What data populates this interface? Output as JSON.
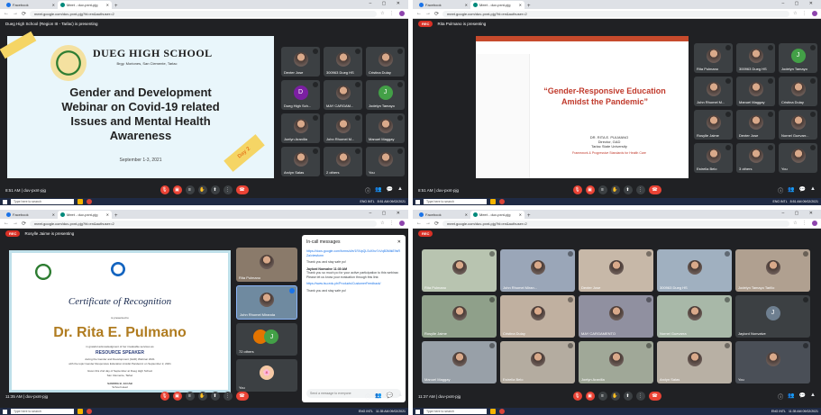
{
  "q1": {
    "tabs": [
      "Facebook",
      "Meet - duv-pxnt-pjg"
    ],
    "url": "meet.google.com/duv-pxnt-pjg?hl=en&authuser=2",
    "presenting": "Dueg High School (Region III - Tarlac) is presenting",
    "slide": {
      "school": "DUEG HIGH SCHOOL",
      "address": "Brgy. Moriones, San Clemente, Tarlac",
      "title_lines": [
        "Gender and Development",
        "Webinar on Covid-19 related",
        "Issues and Mental Health",
        "Awareness"
      ],
      "date": "September 1-3, 2021",
      "badge": "Day 2"
    },
    "participants": [
      {
        "name": "Dexter Jose",
        "letter": "",
        "color": ""
      },
      {
        "name": "300963 Dueg HS",
        "letter": "",
        "color": ""
      },
      {
        "name": "Cristina Dulay",
        "letter": "",
        "color": ""
      },
      {
        "name": "Dueg High Sch...",
        "letter": "D",
        "color": "#7b1fa2"
      },
      {
        "name": "MAY CARGAM...",
        "letter": "",
        "color": ""
      },
      {
        "name": "Jodelyn Tamayo",
        "letter": "J",
        "color": "#43a047"
      },
      {
        "name": "Joelyn Aranilla",
        "letter": "",
        "color": ""
      },
      {
        "name": "John Rhomel M...",
        "letter": "",
        "color": ""
      },
      {
        "name": "Manuel Maggay",
        "letter": "",
        "color": ""
      },
      {
        "name": "Arclyn Salas",
        "letter": "",
        "color": ""
      },
      {
        "name": "2 others",
        "letter": "",
        "color": ""
      },
      {
        "name": "You",
        "letter": "",
        "color": ""
      }
    ],
    "time": "8:51 AM",
    "meeting_code": "duv-pxnt-pjg"
  },
  "q2": {
    "tabs": [
      "Facebook",
      "Meet - duv-pxnt-pjg"
    ],
    "url": "meet.google.com/duv-pxnt-pjg?hl=en&authuser=2",
    "rec": "REC",
    "presenting": "Rita Pulmano is presenting",
    "slide": {
      "title": "“Gender-Responsive Education Amidst the Pandemic”",
      "presenter": "DR. RITA E. PULMANO",
      "role": "Director, GAD",
      "org": "Tarlac State University",
      "foot": "Framework & Progressive Standards for Health Care"
    },
    "participants": [
      {
        "name": "Rita Pulmano",
        "letter": "",
        "color": ""
      },
      {
        "name": "300963 Dueg HS",
        "letter": "",
        "color": ""
      },
      {
        "name": "Jodelyn Tamayo",
        "letter": "J",
        "color": "#43a047"
      },
      {
        "name": "John Rhomel M...",
        "letter": "",
        "color": ""
      },
      {
        "name": "Manuel Maggay",
        "letter": "",
        "color": ""
      },
      {
        "name": "Cristina Dulay",
        "letter": "",
        "color": ""
      },
      {
        "name": "Rosylle Jaime",
        "letter": "",
        "color": ""
      },
      {
        "name": "Dexter Jose",
        "letter": "",
        "color": ""
      },
      {
        "name": "Nornel Guevarr...",
        "letter": "",
        "color": ""
      },
      {
        "name": "Estrella Belo",
        "letter": "",
        "color": ""
      },
      {
        "name": "3 others",
        "letter": "",
        "color": ""
      },
      {
        "name": "You",
        "letter": "",
        "color": ""
      }
    ],
    "time": "8:51 AM",
    "meeting_code": "duv-pxnt-pjg"
  },
  "q3": {
    "tabs": [
      "Facebook",
      "Meet - duv-pxnt-pjg"
    ],
    "url": "meet.google.com/duv-pxnt-pjg?hl=en&authuser=2",
    "rec": "REC",
    "presenting": "Rosylle Jaime is presenting",
    "cert": {
      "heading": "Certificate of Recognition",
      "presented_to": "is presented to",
      "name": "Dr. Rita E. Pulmano",
      "grateful": "in grateful acknowledgment of her invaluable services as",
      "role": "RESOURCE SPEAKER",
      "during": "during the Gender and Development (GAD) Webinar 2021",
      "topic": "with the topic Gender Responsive Education Amidst Pandemic on September 2, 2021",
      "given": "Given this 2nd day of September at Dueg High School",
      "place": "San Clemente, Tarlac",
      "signer": "SANDRA B. JACAB",
      "signer_role": "School Head"
    },
    "side": [
      {
        "name": "Rita Pulmano"
      },
      {
        "name": "John Rhomel Miranda"
      },
      {
        "name": "72 others"
      },
      {
        "name": "You"
      }
    ],
    "chat": {
      "title": "In-call messages",
      "link1": "https://docs.google.com/forms/d/e/1FAIpQLSdXhv7cVqB3MtkE9sRZa/viewform",
      "msg1": "Thank you and stay safe po!",
      "sender": "Jaylord Nonvalve 11:30 AM",
      "msg2": "Thank you so much po for your active participation to this webinar. Please let us know your evaluation through this link:",
      "link2": "https://www.tsu.edu.ph/Products/CustomerFeedback/",
      "msg3": "Thank you and stay safe po!",
      "input_placeholder": "Send a message to everyone"
    },
    "time": "11:35 AM",
    "meeting_code": "duv-pxnt-pjg"
  },
  "q4": {
    "tabs": [
      "Facebook",
      "Meet - duv-pxnt-pjg"
    ],
    "url": "meet.google.com/duv-pxnt-pjg?hl=en&authuser=2",
    "rec": "REC",
    "participants": [
      {
        "name": "Rita Pulmano",
        "letter": "",
        "color": ""
      },
      {
        "name": "John Rhomel Miran...",
        "letter": "",
        "color": ""
      },
      {
        "name": "Dexter Jose",
        "letter": "",
        "color": ""
      },
      {
        "name": "300963 Dueg HS",
        "letter": "",
        "color": ""
      },
      {
        "name": "Jodelyn Tamayo Tarillo",
        "letter": "",
        "color": ""
      },
      {
        "name": "Rosylle Jaime",
        "letter": "",
        "color": ""
      },
      {
        "name": "Cristina Dulay",
        "letter": "",
        "color": ""
      },
      {
        "name": "MAY CARGAMENTO",
        "letter": "",
        "color": ""
      },
      {
        "name": "Nornel Guevarra",
        "letter": "",
        "color": ""
      },
      {
        "name": "Jaylord Nonvalve",
        "letter": "J",
        "color": "#6e7f90"
      },
      {
        "name": "Manuel Maggay",
        "letter": "",
        "color": ""
      },
      {
        "name": "Estrella Belo",
        "letter": "",
        "color": ""
      },
      {
        "name": "Joelyn Aranilla",
        "letter": "",
        "color": ""
      },
      {
        "name": "Arclyn Salas",
        "letter": "",
        "color": ""
      },
      {
        "name": "You",
        "letter": "",
        "color": ""
      }
    ],
    "time": "11:37 AM",
    "meeting_code": "duv-pxnt-pjg"
  },
  "taskbar": {
    "search_placeholder": "Type here to search",
    "lang": "ENG INTL",
    "clock_q1": "8:51 AM 09/02/2021",
    "clock_q3": "11:35 AM 09/02/2021"
  }
}
